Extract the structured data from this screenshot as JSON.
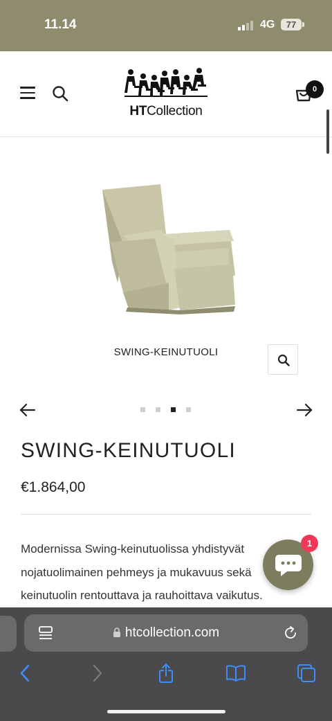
{
  "status_bar": {
    "time": "11.14",
    "network": "4G",
    "battery": "77"
  },
  "header": {
    "logo_text_bold": "HT",
    "logo_text_rest": "Collection",
    "cart_count": "0"
  },
  "product": {
    "image_caption": "SWING-KEINUTUOLI",
    "title": "SWING-KEINUTUOLI",
    "price": "€1.864,00",
    "description_lines": [
      "Modernissa Swing-keinutuolissa yhdistyvät",
      "nojatuolimainen pehmeys ja mukavuus sekä",
      "keinutuolin rentouttava ja rauhoittava vaikutus."
    ]
  },
  "gallery": {
    "image_count": 4,
    "active_index": 2
  },
  "chat": {
    "unread_count": "1"
  },
  "browser": {
    "url": "htcollection.com"
  },
  "colors": {
    "status_bar": "#8e8c6c",
    "chat_button": "#7e7c5e",
    "chat_badge": "#f0385a",
    "ios_link_blue": "#3d8ef6"
  },
  "icons": {
    "menu": "hamburger-icon",
    "search": "search-icon",
    "cart": "cart-icon",
    "zoom": "zoom-search-icon",
    "prev": "arrow-left-icon",
    "next": "arrow-right-icon",
    "chat": "chat-bubble-icon",
    "lock": "lock-icon",
    "reload": "reload-icon",
    "back": "chevron-left-icon",
    "forward": "chevron-right-icon",
    "share": "share-icon",
    "bookmarks": "book-icon",
    "tabs": "tabs-icon"
  }
}
